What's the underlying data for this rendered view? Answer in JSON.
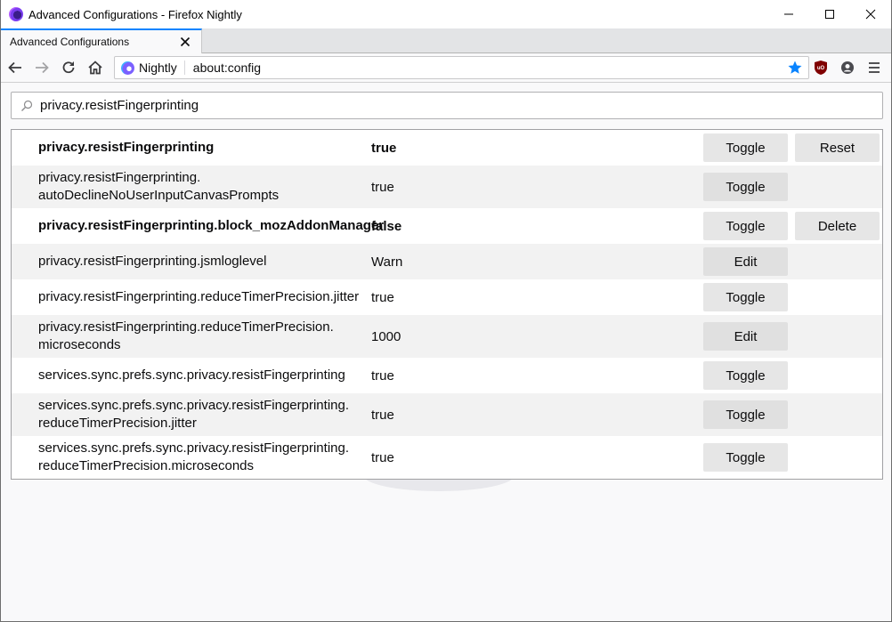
{
  "window": {
    "title": "Advanced Configurations - Firefox Nightly",
    "controls": [
      "minimize",
      "maximize",
      "close"
    ]
  },
  "tabs": [
    {
      "label": "Advanced Configurations",
      "active": true
    }
  ],
  "navbar": {
    "identity_label": "Nightly",
    "url": "about:config",
    "accent_color": "#0a84ff",
    "extensions": [
      "ublock-origin-icon",
      "account-icon",
      "menu-icon"
    ]
  },
  "search": {
    "value": "privacy.resistFingerprinting"
  },
  "prefs": [
    {
      "name_line1": "privacy.resistFingerprinting",
      "name_line2": "",
      "value": "true",
      "modified": true,
      "actions": [
        "Toggle",
        "Reset"
      ]
    },
    {
      "name_line1": "privacy.resistFingerprinting.",
      "name_line2": "autoDeclineNoUserInputCanvasPrompts",
      "value": "true",
      "modified": false,
      "actions": [
        "Toggle"
      ]
    },
    {
      "name_line1": "privacy.resistFingerprinting.block_mozAddonManager",
      "name_line2": "",
      "value": "false",
      "modified": true,
      "actions": [
        "Toggle",
        "Delete"
      ]
    },
    {
      "name_line1": "privacy.resistFingerprinting.jsmloglevel",
      "name_line2": "",
      "value": "Warn",
      "modified": false,
      "actions": [
        "Edit"
      ]
    },
    {
      "name_line1": "privacy.resistFingerprinting.reduceTimerPrecision.jitter",
      "name_line2": "",
      "value": "true",
      "modified": false,
      "actions": [
        "Toggle"
      ]
    },
    {
      "name_line1": "privacy.resistFingerprinting.reduceTimerPrecision.",
      "name_line2": "microseconds",
      "value": "1000",
      "modified": false,
      "actions": [
        "Edit"
      ]
    },
    {
      "name_line1": "services.sync.prefs.sync.privacy.resistFingerprinting",
      "name_line2": "",
      "value": "true",
      "modified": false,
      "actions": [
        "Toggle"
      ]
    },
    {
      "name_line1": "services.sync.prefs.sync.privacy.resistFingerprinting.",
      "name_line2": "reduceTimerPrecision.jitter",
      "value": "true",
      "modified": false,
      "actions": [
        "Toggle"
      ]
    },
    {
      "name_line1": "services.sync.prefs.sync.privacy.resistFingerprinting.",
      "name_line2": "reduceTimerPrecision.microseconds",
      "value": "true",
      "modified": false,
      "actions": [
        "Toggle"
      ]
    }
  ]
}
